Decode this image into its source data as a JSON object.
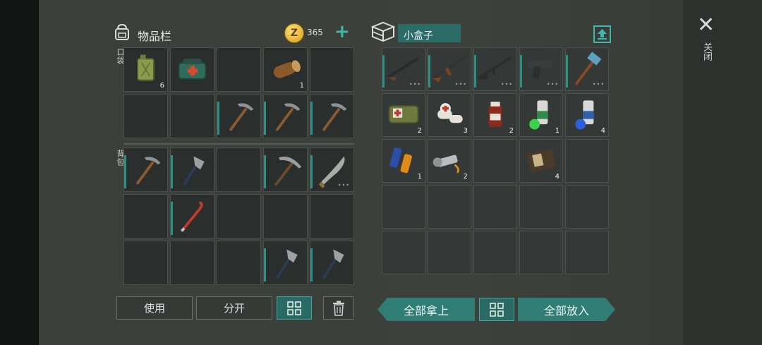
{
  "inventory": {
    "title": "物品栏",
    "coins": "365",
    "pocket_label": "口袋",
    "backpack_label": "背包",
    "pocket_items": [
      {
        "name": "jerrycan",
        "count": "6"
      },
      {
        "name": "medkit-bag",
        "count": ""
      },
      {
        "name": "",
        "count": ""
      },
      {
        "name": "wood-log",
        "count": "1"
      },
      {
        "name": "",
        "count": ""
      },
      {
        "name": "",
        "count": ""
      },
      {
        "name": "",
        "count": ""
      },
      {
        "name": "pickaxe",
        "count": ""
      },
      {
        "name": "pickaxe",
        "count": ""
      },
      {
        "name": "pickaxe",
        "count": ""
      }
    ],
    "backpack_items": [
      {
        "name": "pickaxe",
        "count": ""
      },
      {
        "name": "hatchet",
        "count": ""
      },
      {
        "name": "",
        "count": ""
      },
      {
        "name": "pickaxe-large",
        "count": ""
      },
      {
        "name": "machete",
        "count": ""
      },
      {
        "name": "",
        "count": ""
      },
      {
        "name": "crowbar",
        "count": ""
      },
      {
        "name": "",
        "count": ""
      },
      {
        "name": "",
        "count": ""
      },
      {
        "name": "",
        "count": ""
      },
      {
        "name": "",
        "count": ""
      },
      {
        "name": "",
        "count": ""
      },
      {
        "name": "",
        "count": ""
      },
      {
        "name": "hatchet",
        "count": ""
      },
      {
        "name": "hatchet",
        "count": ""
      }
    ],
    "buttons": {
      "use": "使用",
      "split": "分开"
    }
  },
  "box": {
    "name": "小盒子",
    "items": [
      {
        "name": "shotgun",
        "count": ""
      },
      {
        "name": "ak-rifle",
        "count": ""
      },
      {
        "name": "assault-rifle",
        "count": ""
      },
      {
        "name": "pistol",
        "count": ""
      },
      {
        "name": "sledgehammer",
        "count": ""
      },
      {
        "name": "first-aid-pouch",
        "count": "2"
      },
      {
        "name": "bandage",
        "count": "3"
      },
      {
        "name": "medicine-bottle",
        "count": "2"
      },
      {
        "name": "spray-can-green",
        "count": "1"
      },
      {
        "name": "spray-can-blue",
        "count": "4"
      },
      {
        "name": "batteries",
        "count": "1"
      },
      {
        "name": "flashlight",
        "count": "2"
      },
      {
        "name": "",
        "count": ""
      },
      {
        "name": "wallet",
        "count": "4"
      },
      {
        "name": "",
        "count": ""
      }
    ],
    "take_all": "全部拿上",
    "put_all": "全部放入"
  },
  "close_label": "关闭",
  "colors": {
    "accent": "#2f7d75",
    "accent_light": "#47a79e",
    "panel": "#3d413b"
  }
}
